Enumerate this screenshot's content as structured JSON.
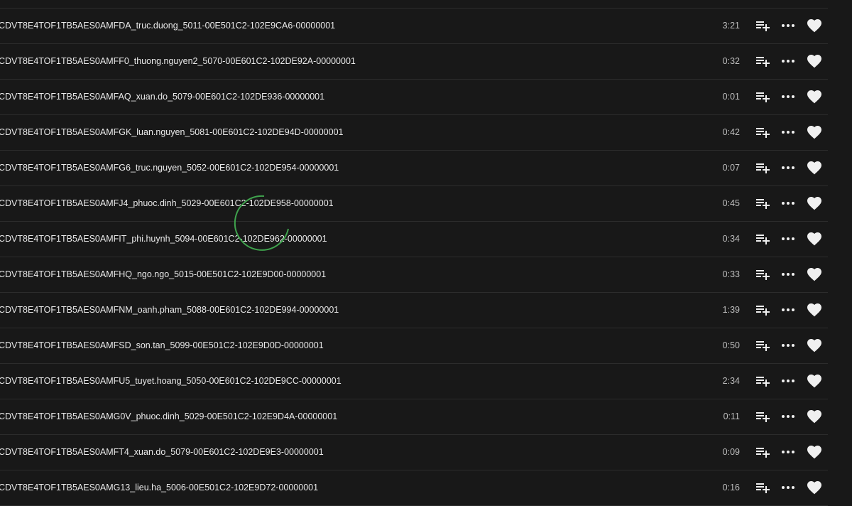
{
  "tracks": [
    {
      "title": "CDVT8E4TOF1TB5AES0AMFDA_truc.duong_5011-00E501C2-102E9CA6-00000001",
      "duration": "3:21"
    },
    {
      "title": "CDVT8E4TOF1TB5AES0AMFF0_thuong.nguyen2_5070-00E601C2-102DE92A-00000001",
      "duration": "0:32"
    },
    {
      "title": "CDVT8E4TOF1TB5AES0AMFAQ_xuan.do_5079-00E601C2-102DE936-00000001",
      "duration": "0:01"
    },
    {
      "title": "CDVT8E4TOF1TB5AES0AMFGK_luan.nguyen_5081-00E601C2-102DE94D-00000001",
      "duration": "0:42"
    },
    {
      "title": "CDVT8E4TOF1TB5AES0AMFG6_truc.nguyen_5052-00E601C2-102DE954-00000001",
      "duration": "0:07"
    },
    {
      "title": "CDVT8E4TOF1TB5AES0AMFJ4_phuoc.dinh_5029-00E601C2-102DE958-00000001",
      "duration": "0:45"
    },
    {
      "title": "CDVT8E4TOF1TB5AES0AMFIT_phi.huynh_5094-00E601C2-102DE962-00000001",
      "duration": "0:34"
    },
    {
      "title": "CDVT8E4TOF1TB5AES0AMFHQ_ngo.ngo_5015-00E501C2-102E9D00-00000001",
      "duration": "0:33"
    },
    {
      "title": "CDVT8E4TOF1TB5AES0AMFNM_oanh.pham_5088-00E601C2-102DE994-00000001",
      "duration": "1:39"
    },
    {
      "title": "CDVT8E4TOF1TB5AES0AMFSD_son.tan_5099-00E501C2-102E9D0D-00000001",
      "duration": "0:50"
    },
    {
      "title": "CDVT8E4TOF1TB5AES0AMFU5_tuyet.hoang_5050-00E601C2-102DE9CC-00000001",
      "duration": "2:34"
    },
    {
      "title": "CDVT8E4TOF1TB5AES0AMG0V_phuoc.dinh_5029-00E501C2-102E9D4A-00000001",
      "duration": "0:11"
    },
    {
      "title": "CDVT8E4TOF1TB5AES0AMFT4_xuan.do_5079-00E601C2-102DE9E3-00000001",
      "duration": "0:09"
    },
    {
      "title": "CDVT8E4TOF1TB5AES0AMG13_lieu.ha_5006-00E501C2-102E9D72-00000001",
      "duration": "0:16"
    }
  ],
  "icons": {
    "queue": "playlist-add-icon",
    "more": "more-horizontal-icon",
    "like": "heart-icon",
    "loading": "loading-spinner"
  },
  "colors": {
    "background": "#181818",
    "text": "#eaeaea",
    "muted": "#bdbdbd",
    "divider": "#2c2c2c",
    "spinner": "#3fa34d"
  }
}
